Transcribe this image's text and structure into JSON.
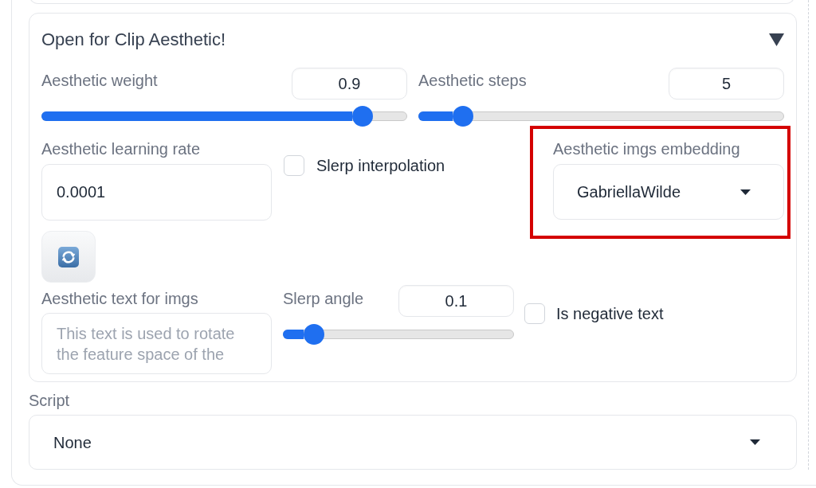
{
  "accordion": {
    "title": "Open for Clip Aesthetic!",
    "expanded": true,
    "aesthetic_weight": {
      "label": "Aesthetic weight",
      "value": "0.9",
      "level": 0.9
    },
    "aesthetic_steps": {
      "label": "Aesthetic steps",
      "value": "5",
      "level": 0.1
    },
    "aesthetic_learning_rate": {
      "label": "Aesthetic learning rate",
      "value": "0.0001"
    },
    "slerp_interpolation": {
      "label": "Slerp interpolation",
      "checked": false
    },
    "aesthetic_imgs_embedding": {
      "label": "Aesthetic imgs embedding",
      "value": "GabriellaWilde",
      "highlighted": true
    },
    "aesthetic_text_for_imgs": {
      "label": "Aesthetic text for imgs",
      "placeholder": "This text is used to rotate the feature space of the"
    },
    "slerp_angle": {
      "label": "Slerp angle",
      "value": "0.1",
      "level": 0.1
    },
    "is_negative_text": {
      "label": "Is negative text",
      "checked": false
    }
  },
  "script": {
    "label": "Script",
    "value": "None"
  }
}
